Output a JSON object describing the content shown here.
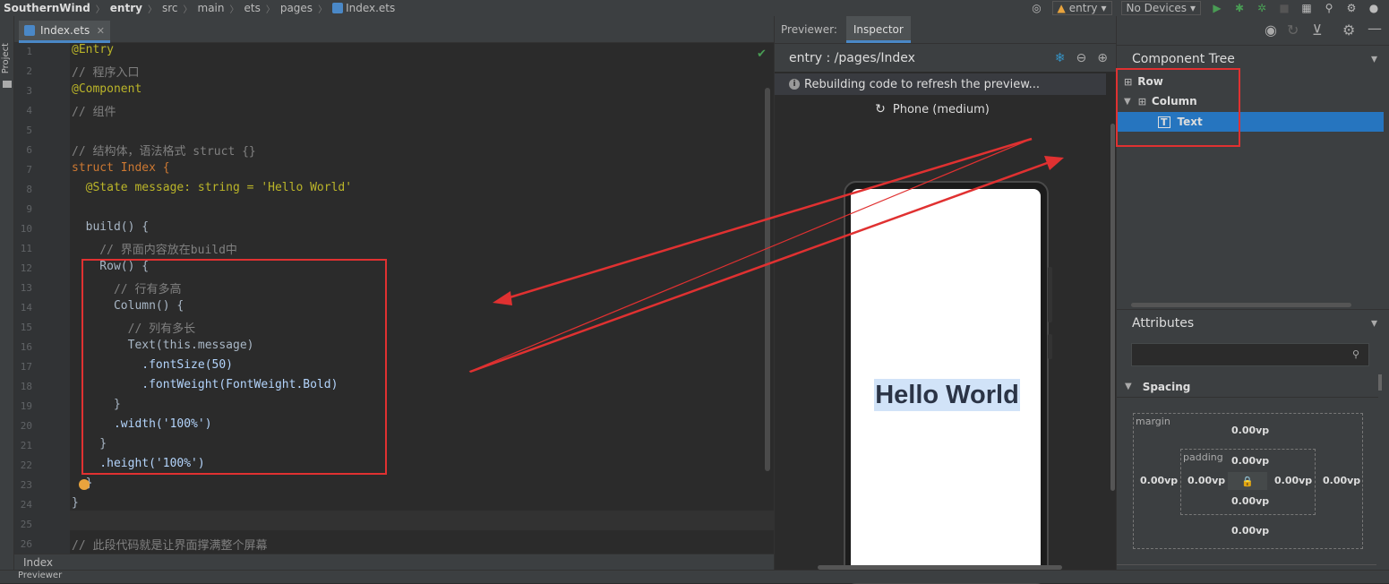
{
  "topbar": {
    "breadcrumbs": [
      "SouthernWind",
      "entry",
      "src",
      "main",
      "ets",
      "pages",
      "Index.ets"
    ],
    "module_select": "entry",
    "device_select": "No Devices"
  },
  "left_strip": {
    "project_label": "Project"
  },
  "editor": {
    "tab_label": "Index.ets",
    "line_numbers": [
      "1",
      "2",
      "3",
      "4",
      "5",
      "6",
      "7",
      "8",
      "9",
      "10",
      "11",
      "12",
      "13",
      "14",
      "15",
      "16",
      "17",
      "18",
      "19",
      "20",
      "21",
      "22",
      "23",
      "24",
      "25",
      "26"
    ],
    "lines": [
      "@Entry",
      "// 程序入口",
      "@Component",
      "// 组件",
      "",
      "// 结构体，语法格式 struct {}",
      "struct Index {",
      "  @State message: string = 'Hello World'",
      "",
      "  build() {",
      "    // 界面内容放在build中",
      "    Row() {",
      "      // 行有多高",
      "      Column() {",
      "        // 列有多长",
      "        Text(this.message)",
      "          .fontSize(50)",
      "          .fontWeight(FontWeight.Bold)",
      "      }",
      "      .width('100%')",
      "    }",
      "    .height('100%')",
      "  }",
      "}",
      "",
      "// 此段代码就是让界面撑满整个屏幕"
    ],
    "file_footer": "Index"
  },
  "bottom_bar": {
    "label": "Previewer"
  },
  "previewer": {
    "tab_previewer": "Previewer:",
    "tab_inspector": "Inspector",
    "page_path": "entry : /pages/Index",
    "rebuild_message": "Rebuilding code to refresh the preview...",
    "device_name": "Phone (medium)",
    "phone_text": "Hello World"
  },
  "right_panel": {
    "component_tree_title": "Component Tree",
    "tree": [
      {
        "label": "Row",
        "depth": 0,
        "selected": false
      },
      {
        "label": "Column",
        "depth": 1,
        "selected": false
      },
      {
        "label": "Text",
        "depth": 2,
        "selected": true
      }
    ],
    "attributes_title": "Attributes",
    "spacing_title": "Spacing",
    "margin_label": "margin",
    "padding_label": "padding",
    "margin_top": "0.00vp",
    "margin_left": "0.00vp",
    "margin_right": "0.00vp",
    "margin_bottom": "0.00vp",
    "padding_top": "0.00vp",
    "padding_left": "0.00vp",
    "padding_right": "0.00vp",
    "padding_bottom": "0.00vp"
  },
  "colors": {
    "selection": "#2675bf",
    "annotation_red": "#e03131",
    "accent_green": "#499c54"
  }
}
